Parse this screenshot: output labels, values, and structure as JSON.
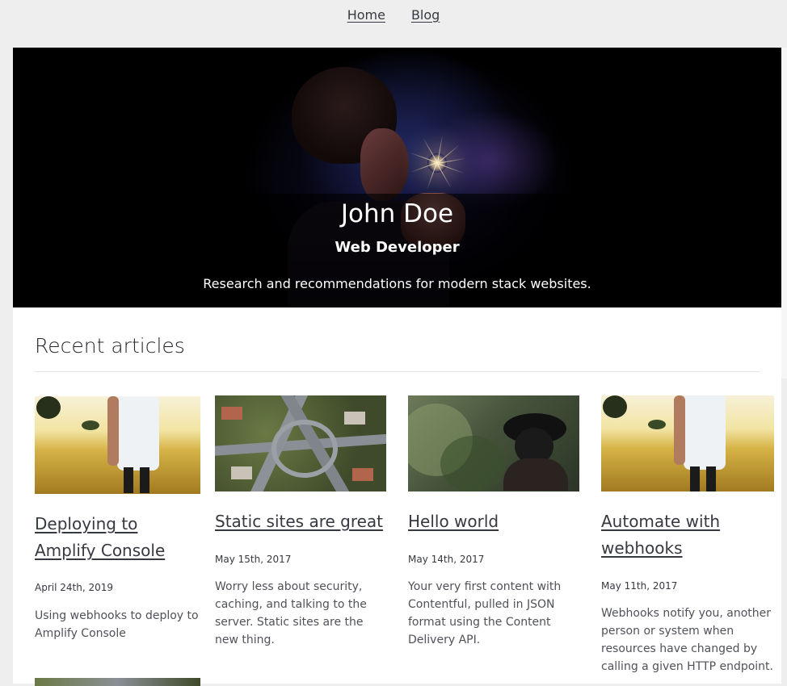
{
  "nav": {
    "home_label": "Home",
    "blog_label": "Blog"
  },
  "hero": {
    "name": "John Doe",
    "role": "Web Developer",
    "tagline": "Research and recommendations for modern stack websites."
  },
  "recent": {
    "title": "Recent articles",
    "articles": [
      {
        "title": "Deploying to Amplify Console",
        "date": "April 24th, 2019",
        "description": "Using webhooks to deploy to Amplify Console",
        "thumb": "field-icon"
      },
      {
        "title": "Static sites are great",
        "date": "May 15th, 2017",
        "description": "Worry less about security, caching, and talking to the server. Static sites are the new thing.",
        "thumb": "highway-icon"
      },
      {
        "title": "Hello world",
        "date": "May 14th, 2017",
        "description": "Your very first content with Contentful, pulled in JSON format using the Content Delivery API.",
        "thumb": "forest-icon"
      },
      {
        "title": "Automate with webhooks",
        "date": "May 11th, 2017",
        "description": "Webhooks notify you, another person or system when resources have changed by calling a given HTTP endpoint.",
        "thumb": "field-icon"
      }
    ]
  }
}
